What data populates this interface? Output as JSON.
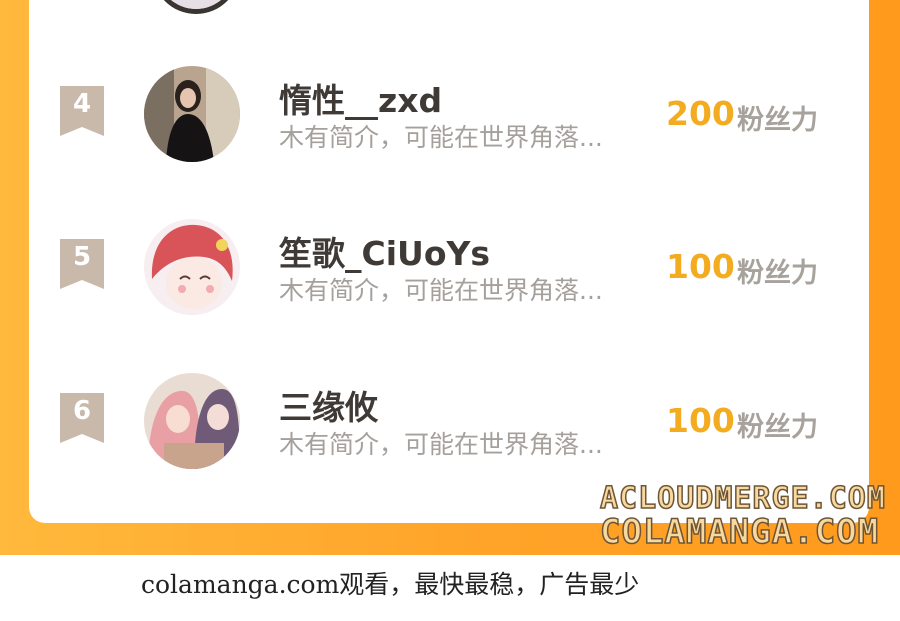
{
  "ranking": {
    "rows": [
      {
        "rank": "4",
        "name": "惰性__zxd",
        "bio": "木有简介，可能在世界角落...",
        "score": "200",
        "unit": "粉丝力"
      },
      {
        "rank": "5",
        "name": "笙歌_CiUoYs",
        "bio": "木有简介，可能在世界角落...",
        "score": "100",
        "unit": "粉丝力"
      },
      {
        "rank": "6",
        "name": "三缘攸",
        "bio": "木有简介，可能在世界角落...",
        "score": "100",
        "unit": "粉丝力"
      }
    ]
  },
  "watermark": {
    "line1": "ACLOUDMERGE.COM",
    "line2": "COLAMANGA.COM"
  },
  "footer": {
    "text": "colamanga.com观看，最快最稳，广告最少"
  },
  "colors": {
    "accent_orange": "#ffa52a",
    "score_gold": "#f3ac1f",
    "rank_badge": "#c8b9ab"
  }
}
